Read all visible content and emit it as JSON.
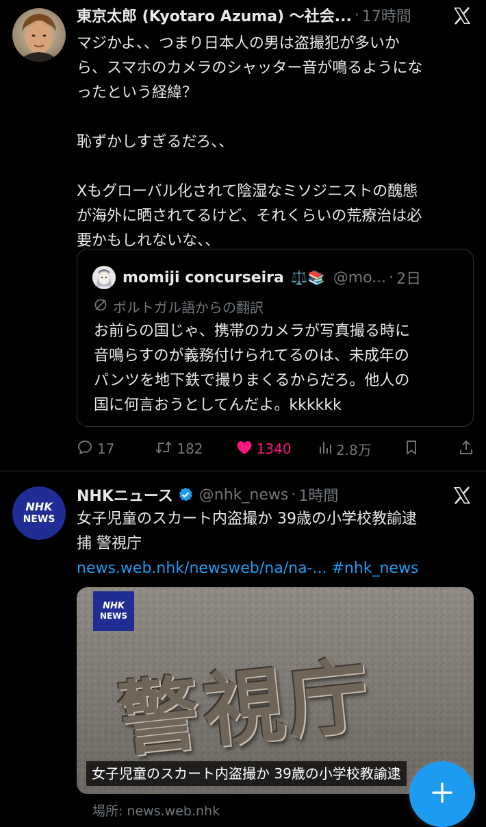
{
  "tweet1": {
    "display_name": "東京太郎 (Kyotaro Azuma) 〜社会...",
    "time": "17時間",
    "body": "マジかよ、、つまり日本人の男は盗撮犯が多いか\nら、スマホのカメラのシャッター音が鳴るようにな\nったという経緯？\n\n恥ずかしすぎるだろ、、\n\nXもグローバル化されて陰湿なミソジニストの醜態\nが海外に晒されてるけど、それくらいの荒療治は必\n要かもしれないな、、",
    "quote": {
      "display_name": "momiji concurseira",
      "emoji": "⚖️📚",
      "handle": "@mo...",
      "time": "2日",
      "translation_note": "ポルトガル語からの翻訳",
      "body": "お前らの国じゃ、携帯のカメラが写真撮る時に\n音鳴らすのが義務付けられてるのは、未成年の\nパンツを地下鉄で撮りまくるからだろ。他人の\n国に何言おうとしてんだよ。kkkkkk"
    },
    "actions": {
      "replies": "17",
      "reposts": "182",
      "likes": "1340",
      "views": "2.8万"
    }
  },
  "tweet2": {
    "display_name": "NHKニュース",
    "handle": "@nhk_news",
    "time": "1時間",
    "avatar_text_top": "NHK",
    "avatar_text_bottom": "NEWS",
    "body": "女子児童のスカート内盗撮か 39歳の小学校教諭逮\n捕 警視庁",
    "link": "news.web.nhk/newsweb/na/na-...",
    "hashtag": "#nhk_news",
    "card": {
      "logo_top": "NHK",
      "logo_bottom": "NEWS",
      "sign_text": "警視庁",
      "caption": "女子児童のスカート内盗撮か 39歳の小学校教諭逮",
      "source_label": "場所: news.web.nhk"
    }
  },
  "fab": {
    "icon": "plus-icon"
  },
  "colors": {
    "background": "#000000",
    "text": "#e7e9ea",
    "muted": "#71767b",
    "accent": "#1d9bf0",
    "like": "#f91880",
    "border": "#2f3336"
  }
}
